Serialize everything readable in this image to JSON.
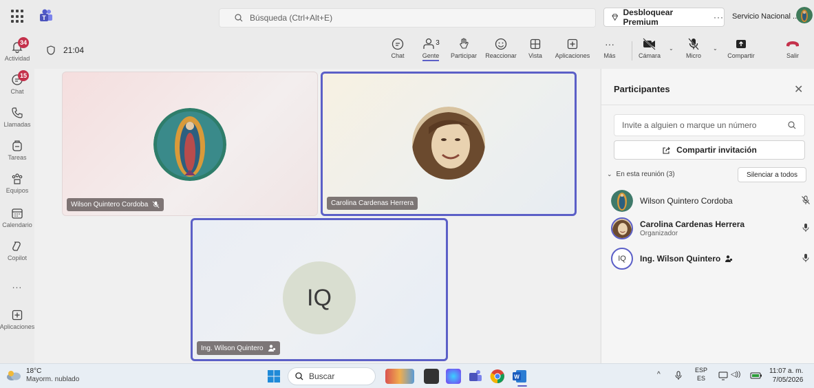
{
  "topbar": {
    "search_placeholder": "Búsqueda (Ctrl+Alt+E)",
    "premium_label": "Desbloquear Premium",
    "premium_more": "···",
    "org_name": "Servicio Nacional ..."
  },
  "rail": {
    "items": [
      {
        "label": "Actividad",
        "badge": "34",
        "icon": "bell-icon"
      },
      {
        "label": "Chat",
        "badge": "15",
        "icon": "chat-icon"
      },
      {
        "label": "Llamadas",
        "icon": "phone-icon"
      },
      {
        "label": "Tareas",
        "icon": "tasks-icon"
      },
      {
        "label": "Equipos",
        "icon": "teams-icon"
      },
      {
        "label": "Calendario",
        "icon": "calendar-icon"
      },
      {
        "label": "Copilot",
        "icon": "copilot-icon"
      },
      {
        "label": "...",
        "icon": "more-icon"
      },
      {
        "label": "Aplicaciones",
        "icon": "apps-icon"
      }
    ]
  },
  "meeting": {
    "time": "21:04",
    "controls": {
      "chat": "Chat",
      "people": "Gente",
      "people_count": "3",
      "raise": "Participar",
      "react": "Reaccionar",
      "view": "Vista",
      "apps": "Aplicaciones",
      "more": "Más",
      "camera": "Cámara",
      "mic": "Micro",
      "share": "Compartir",
      "leave": "Salir"
    }
  },
  "tiles": [
    {
      "name": "Wilson Quintero Cordoba",
      "muted": true
    },
    {
      "name": "Carolina Cardenas Herrera",
      "speaking": true
    },
    {
      "name": "Ing. Wilson Quintero",
      "initials": "IQ",
      "speaking": true
    }
  ],
  "panel": {
    "title": "Participantes",
    "invite_placeholder": "Invite a alguien o marque un número",
    "share_invite": "Compartir invitación",
    "section_label": "En esta reunión (3)",
    "mute_all": "Silenciar a todos",
    "participants": [
      {
        "name": "Wilson Quintero Cordoba",
        "role": "",
        "mic": "muted"
      },
      {
        "name": "Carolina Cardenas Herrera",
        "role": "Organizador",
        "mic": "on"
      },
      {
        "name": "Ing. Wilson Quintero",
        "initials": "IQ",
        "role": "",
        "mic": "on"
      }
    ]
  },
  "taskbar": {
    "temp": "18°C",
    "weather": "Mayorm. nublado",
    "search": "Buscar",
    "lang1": "ESP",
    "lang2": "ES",
    "time": "11:07 a. m.",
    "date": "7/05/2026"
  },
  "colors": {
    "accent": "#5b5fc7",
    "badge": "#c4314b",
    "leave": "#c4314b"
  }
}
